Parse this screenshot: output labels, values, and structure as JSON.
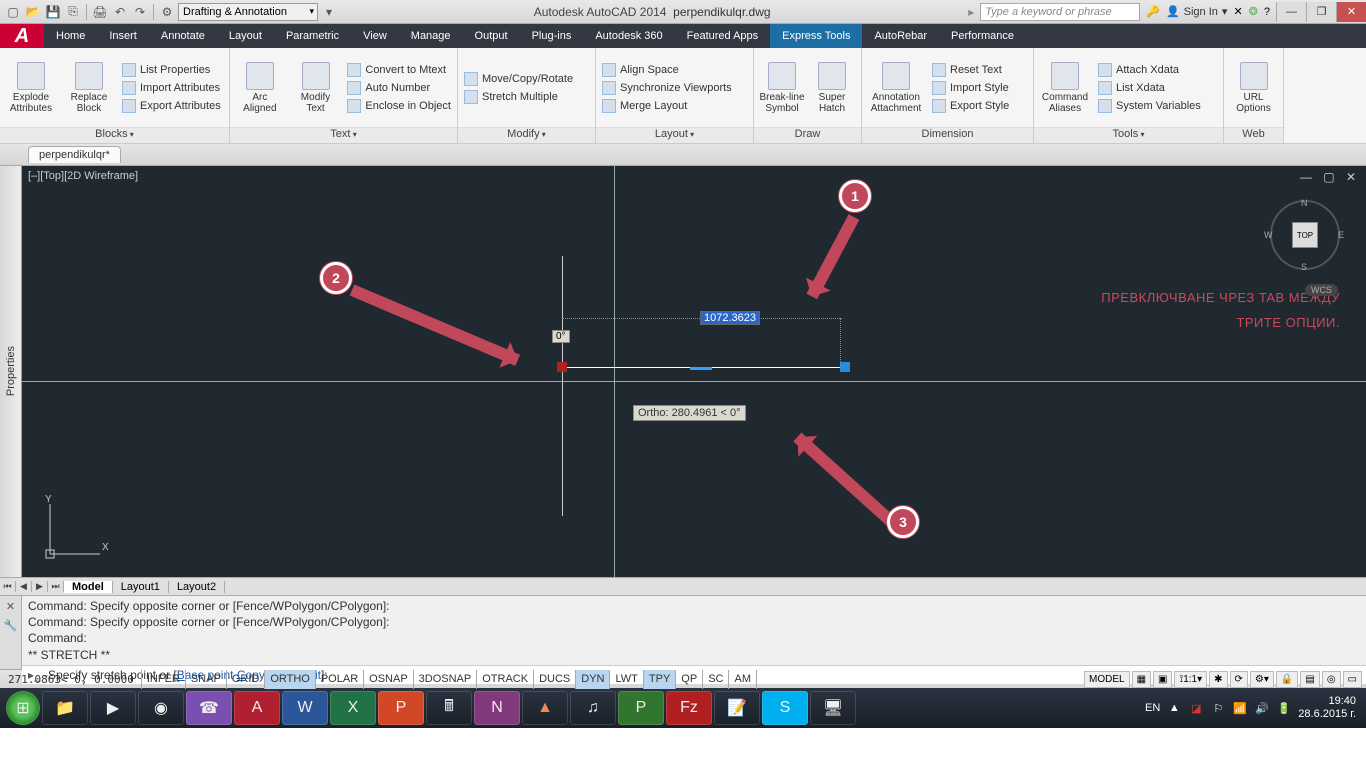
{
  "title": {
    "app": "Autodesk AutoCAD 2014",
    "file": "perpendikulqr.dwg"
  },
  "workspace": "Drafting & Annotation",
  "search_placeholder": "Type a keyword or phrase",
  "signin": "Sign In",
  "menu_tabs": [
    "Home",
    "Insert",
    "Annotate",
    "Layout",
    "Parametric",
    "View",
    "Manage",
    "Output",
    "Plug-ins",
    "Autodesk 360",
    "Featured Apps",
    "Express Tools",
    "AutoRebar",
    "Performance"
  ],
  "active_tab": "Express Tools",
  "ribbon": {
    "blocks": {
      "label": "Blocks",
      "explode": "Explode\nAttributes",
      "replace": "Replace\nBlock",
      "items": [
        "List Properties",
        "Import Attributes",
        "Export Attributes"
      ]
    },
    "text": {
      "label": "Text",
      "arc": "Arc\nAligned",
      "modify": "Modify\nText",
      "items": [
        "Convert to Mtext",
        "Auto Number",
        "Enclose in Object"
      ]
    },
    "modify": {
      "label": "Modify",
      "items": [
        "Move/Copy/Rotate",
        "Stretch Multiple"
      ]
    },
    "layout": {
      "label": "Layout",
      "items": [
        "Align Space",
        "Synchronize Viewports",
        "Merge Layout"
      ]
    },
    "draw": {
      "label": "Draw",
      "breakline": "Break-line\nSymbol",
      "hatch": "Super\nHatch"
    },
    "dimension": {
      "label": "Dimension",
      "attach": "Annotation\nAttachment",
      "items": [
        "Reset Text",
        "Import Style",
        "Export Style"
      ]
    },
    "tools": {
      "label": "Tools",
      "aliases": "Command\nAliases",
      "items": [
        "Attach Xdata",
        "List Xdata",
        "System Variables"
      ]
    },
    "web": {
      "label": "Web",
      "url": "URL\nOptions"
    }
  },
  "file_tab": "perpendikulqr*",
  "viewport_label": "[–][Top][2D Wireframe]",
  "navcube": {
    "face": "TOP",
    "wcs": "WCS"
  },
  "annotation_text": {
    "l1": "ПРЕВКЛЮЧВАНЕ ЧРЕЗ TAB МЕЖДУ",
    "l2": "ТРИТЕ ОПЦИИ."
  },
  "dynamic_input": {
    "value": "1072.3623",
    "angle": "0°",
    "ortho": "Ortho: 280.4961 < 0°"
  },
  "callouts": {
    "c1": "1",
    "c2": "2",
    "c3": "3"
  },
  "layout_tabs": [
    "Model",
    "Layout1",
    "Layout2"
  ],
  "cmd_history": [
    "Command: Specify opposite corner or [Fence/WPolygon/CPolygon]:",
    "Command: Specify opposite corner or [Fence/WPolygon/CPolygon]:",
    "Command:",
    "** STRETCH **"
  ],
  "cmd_prompt": {
    "lead": "Specify stretch point or [",
    "opts": [
      "Base point",
      "Copy",
      "Undo",
      "eXit"
    ],
    "tail": "]:"
  },
  "coords": "271.0863< 0, 0.0000",
  "status_toggles": [
    {
      "t": "INFER",
      "on": false
    },
    {
      "t": "SNAP",
      "on": false
    },
    {
      "t": "GRID",
      "on": false
    },
    {
      "t": "ORTHO",
      "on": true
    },
    {
      "t": "POLAR",
      "on": false
    },
    {
      "t": "OSNAP",
      "on": false
    },
    {
      "t": "3DOSNAP",
      "on": false
    },
    {
      "t": "OTRACK",
      "on": false
    },
    {
      "t": "DUCS",
      "on": false
    },
    {
      "t": "DYN",
      "on": true
    },
    {
      "t": "LWT",
      "on": false
    },
    {
      "t": "TPY",
      "on": true
    },
    {
      "t": "QP",
      "on": false
    },
    {
      "t": "SC",
      "on": false
    },
    {
      "t": "AM",
      "on": false
    }
  ],
  "status_right": {
    "model": "MODEL",
    "scale": "1:1"
  },
  "tray": {
    "lang": "EN",
    "time": "19:40",
    "date": "28.6.2015 г."
  }
}
